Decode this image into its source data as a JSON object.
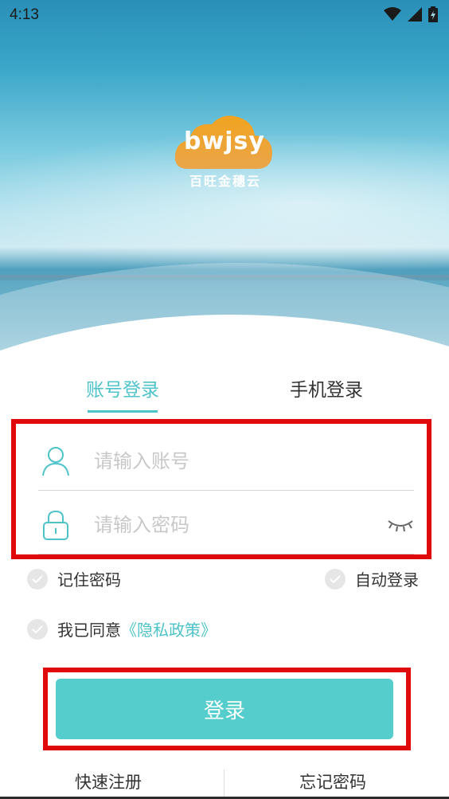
{
  "status_bar": {
    "time": "4:13",
    "icons": [
      "wifi-icon",
      "signal-icon",
      "battery-icon"
    ]
  },
  "logo": {
    "brand": "bwjsy",
    "subtitle": "百旺金穗云",
    "accent_color": "#f0a22c"
  },
  "tabs": [
    {
      "label": "账号登录",
      "active": true
    },
    {
      "label": "手机登录",
      "active": false
    }
  ],
  "form": {
    "username_placeholder": "请输入账号",
    "username_value": "",
    "password_placeholder": "请输入密码",
    "password_value": "",
    "user_icon": "user-icon",
    "lock_icon": "lock-icon",
    "visibility_icon": "eye-closed-icon"
  },
  "options": {
    "remember_label": "记住密码",
    "auto_login_label": "自动登录",
    "agree_label": "我已同意",
    "policy_link": "《隐私政策》"
  },
  "login_button": "登录",
  "bottom": {
    "register": "快速注册",
    "forgot": "忘记密码"
  },
  "colors": {
    "accent": "#4ec3c8",
    "button": "#55cdcc",
    "highlight_border": "#e0090b"
  }
}
